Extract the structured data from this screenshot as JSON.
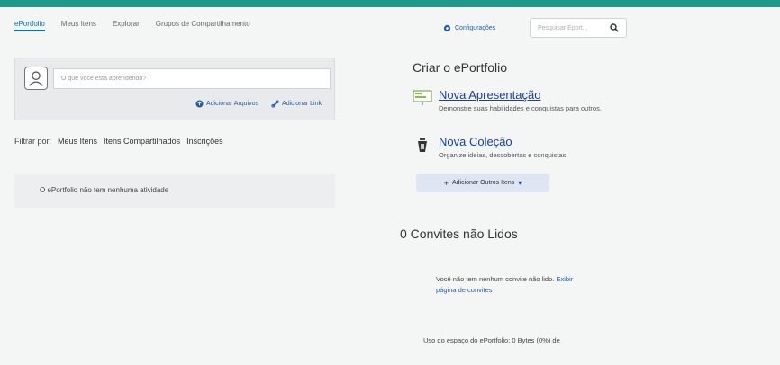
{
  "nav": {
    "tabs": [
      {
        "label": "ePortfolio",
        "active": true
      },
      {
        "label": "Meus Itens",
        "active": false
      },
      {
        "label": "Explorar",
        "active": false
      },
      {
        "label": "Grupos de Compartilhamento",
        "active": false
      }
    ]
  },
  "header": {
    "config_label": "Configurações",
    "search_placeholder": "Pesquisar Eport..."
  },
  "compose": {
    "placeholder": "O que você está aprendendo?",
    "add_files": "Adicionar Arquivos",
    "add_link": "Adicionar Link"
  },
  "filter": {
    "label": "Filtrar por:",
    "options": [
      "Meus Itens",
      "Itens Compartilhados",
      "Inscrições"
    ]
  },
  "feed": {
    "empty": "O ePortfolio não tem nenhuma atividade"
  },
  "create": {
    "title": "Criar o ePortfolio",
    "items": [
      {
        "title": "Nova Apresentação",
        "desc": "Demonstre suas habilidades e conquistas para outros."
      },
      {
        "title": "Nova Coleção",
        "desc": "Organize ideias, descobertas e conquistas."
      }
    ],
    "other_items": "Adicionar Outros Itens"
  },
  "invites": {
    "title": "0 Convites não Lidos",
    "text": "Você não tem nenhum convite não lido.",
    "link": "Exibir página de convites"
  },
  "usage": "Uso do espaço do ePortfolio: 0 Bytes (0%) de",
  "colors": {
    "accent": "#1f9a8a",
    "link": "#1b3fa0"
  }
}
